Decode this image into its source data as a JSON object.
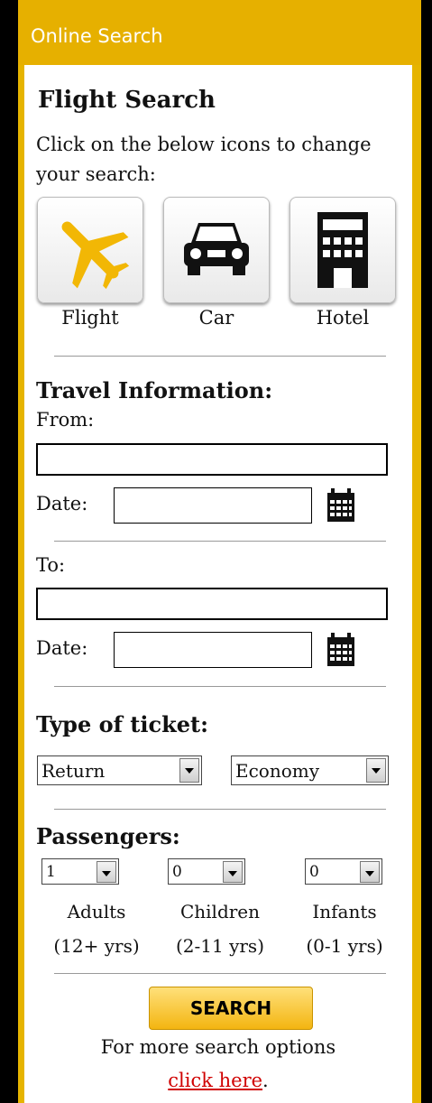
{
  "header": {
    "title": "Online Search"
  },
  "search": {
    "title": "Flight Search",
    "instructions": "Click on the below icons to change your search:",
    "modes": [
      {
        "label": "Flight",
        "icon": "airplane-icon"
      },
      {
        "label": "Car",
        "icon": "car-icon"
      },
      {
        "label": "Hotel",
        "icon": "hotel-icon"
      }
    ]
  },
  "travel": {
    "title": "Travel Information:",
    "from_label": "From:",
    "from_value": "",
    "from_date_label": "Date:",
    "from_date_value": "",
    "to_label": "To:",
    "to_value": "",
    "to_date_label": "Date:",
    "to_date_value": ""
  },
  "ticket": {
    "title": "Type of ticket:",
    "trip_type": "Return",
    "cabin_class": "Economy"
  },
  "passengers": {
    "title": "Passengers:",
    "adults": {
      "value": "1",
      "label": "Adults",
      "range": "(12+ yrs)"
    },
    "children": {
      "value": "0",
      "label": "Children",
      "range": "(2-11 yrs)"
    },
    "infants": {
      "value": "0",
      "label": "Infants",
      "range": "(0-1 yrs)"
    }
  },
  "actions": {
    "search_label": "SEARCH",
    "more_text": "For more search options",
    "link_text": "click here",
    "link_suffix": "."
  },
  "colors": {
    "accent": "#e6b000",
    "link": "#d00000",
    "button": "#f3b511"
  }
}
